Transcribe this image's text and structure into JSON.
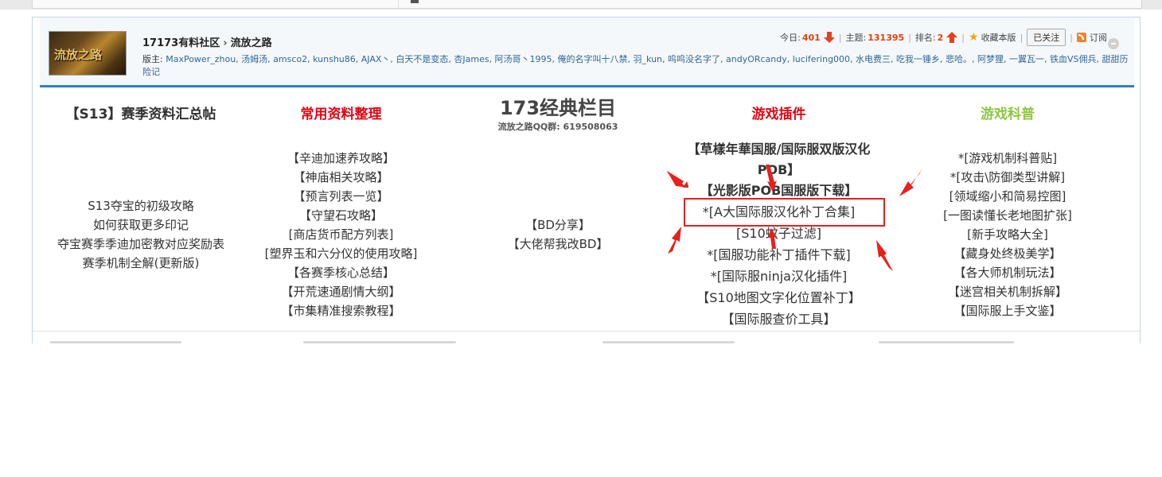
{
  "forum": {
    "breadcrumb_home": "17173有料社区",
    "breadcrumb_sep": "›",
    "breadcrumb_current": "流放之路",
    "logo_text": "流放之路",
    "moderators_label": "版主:",
    "moderators": "MaxPower_zhou, 汤姆汤, amsco2, kunshu86, AJAX丶, 白天不是变态, 杏James, 阿汤哥丶1995, 俺的名字叫十八禁, 羽_kun, 呜呜没名字了, andyORcandy, lucifering000, 水电费三, 吃我一锤乡, 悲哈。, 阿梦狸, 一翼瓦一, 铁血VS佣兵, 甜甜历险记"
  },
  "stats": {
    "today_label": "今日:",
    "today_value": "401",
    "topics_label": "主题:",
    "topics_value": "131395",
    "rank_label": "排名:",
    "rank_value": "2",
    "favorite_label": "收藏本版",
    "follow_label": "已关注",
    "subscribe_label": "订阅"
  },
  "columns": {
    "c1": {
      "head": "【S13】赛季资料汇总帖",
      "head_color": "#333333",
      "items": [
        "S13夺宝的初级攻略",
        "如何获取更多印记",
        "夺宝赛季季迪加密教对应奖励表",
        "赛季机制全解(更新版)"
      ]
    },
    "c2": {
      "head": "常用资料整理",
      "head_color": "#e60012",
      "items": [
        "【辛迪加速养攻略】",
        "【神庙相关攻略】",
        "【预言列表一览】",
        "【守望石攻略】",
        "[商店货币配方列表]",
        "[塑界玉和六分仪的使用攻略]",
        "【各赛季核心总结】",
        "【开荒速通剧情大纲】",
        "【市集精准搜索教程】"
      ]
    },
    "c3": {
      "head": "173经典栏目",
      "sub": "流放之路QQ群:   619508063",
      "items": [
        "【BD分享】",
        "【大佬帮我改BD】"
      ]
    },
    "c4": {
      "head": "游戏插件",
      "head_color": "#e60012",
      "bold1a": "【草樣年華国服/国际服双版汉化",
      "bold1b": "POB】",
      "bold2": "【光影版POB国服版下载】",
      "items": [
        "*[A大国际服汉化补丁合集]",
        "[S10蚊子过滤]",
        "*[国服功能补丁插件下载]",
        "*[国际服ninja汉化插件]",
        "【S10地图文字化位置补丁】",
        "【国际服查价工具】"
      ]
    },
    "c5": {
      "head": "游戏科普",
      "head_color": "#8cc63f",
      "items": [
        "*[游戏机制科普贴]",
        "*[攻击\\防御类型讲解]",
        "[领域缩小和简易控图]",
        "[一图读懂长老地图扩张]",
        "[新手攻略大全]",
        "【藏身处终极美学】",
        "【各大师机制玩法】",
        "【迷宫相关机制拆解】",
        "【国际服上手文鉴】"
      ]
    }
  },
  "colors": {
    "accent_blue": "#2d7fcb",
    "annotation_red": "#e8201c",
    "link_blue": "#336699"
  }
}
